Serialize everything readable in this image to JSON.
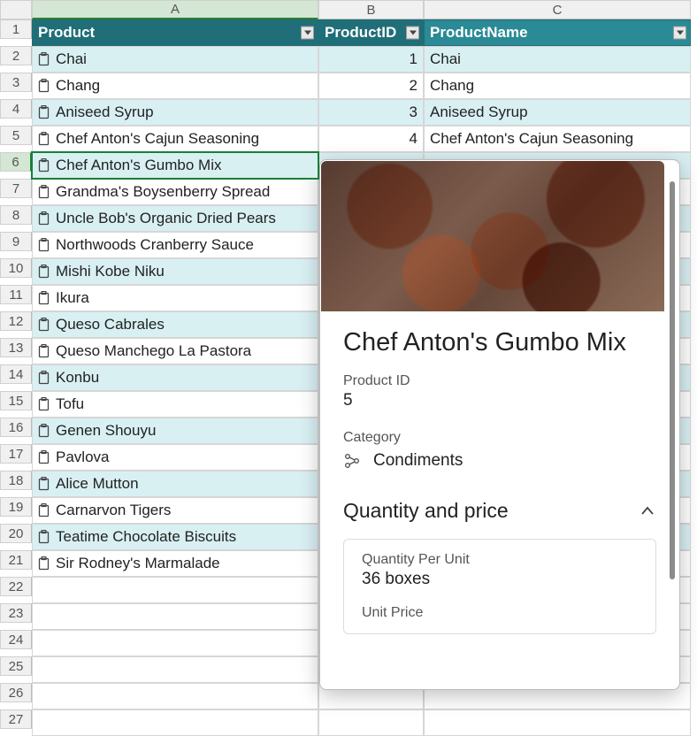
{
  "columns": {
    "A": "A",
    "B": "B",
    "C": "C"
  },
  "headers": {
    "product": "Product",
    "product_id": "ProductID",
    "product_name": "ProductName"
  },
  "rows": [
    {
      "product": "Chai",
      "id": "1",
      "name": "Chai"
    },
    {
      "product": "Chang",
      "id": "2",
      "name": "Chang"
    },
    {
      "product": "Aniseed Syrup",
      "id": "3",
      "name": "Aniseed Syrup"
    },
    {
      "product": "Chef Anton's Cajun Seasoning",
      "id": "4",
      "name": "Chef Anton's Cajun Seasoning"
    },
    {
      "product": "Chef Anton's Gumbo Mix",
      "id": "",
      "name": ""
    },
    {
      "product": "Grandma's Boysenberry Spread",
      "id": "",
      "name": ""
    },
    {
      "product": "Uncle Bob's Organic Dried Pears",
      "id": "",
      "name": ""
    },
    {
      "product": "Northwoods Cranberry Sauce",
      "id": "",
      "name": ""
    },
    {
      "product": "Mishi Kobe Niku",
      "id": "",
      "name": ""
    },
    {
      "product": "Ikura",
      "id": "",
      "name": ""
    },
    {
      "product": "Queso Cabrales",
      "id": "",
      "name": ""
    },
    {
      "product": "Queso Manchego La Pastora",
      "id": "",
      "name": ""
    },
    {
      "product": "Konbu",
      "id": "",
      "name": ""
    },
    {
      "product": "Tofu",
      "id": "",
      "name": ""
    },
    {
      "product": "Genen Shouyu",
      "id": "",
      "name": ""
    },
    {
      "product": "Pavlova",
      "id": "",
      "name": ""
    },
    {
      "product": "Alice Mutton",
      "id": "",
      "name": ""
    },
    {
      "product": "Carnarvon Tigers",
      "id": "",
      "name": ""
    },
    {
      "product": "Teatime Chocolate Biscuits",
      "id": "",
      "name": ""
    },
    {
      "product": "Sir Rodney's Marmalade",
      "id": "",
      "name": ""
    }
  ],
  "row_numbers": [
    "1",
    "2",
    "3",
    "4",
    "5",
    "6",
    "7",
    "8",
    "9",
    "10",
    "11",
    "12",
    "13",
    "14",
    "15",
    "16",
    "17",
    "18",
    "19",
    "20",
    "21",
    "22",
    "23",
    "24",
    "25",
    "26",
    "27"
  ],
  "selected_row_index": 4,
  "card": {
    "title": "Chef Anton's Gumbo Mix",
    "product_id_label": "Product ID",
    "product_id_value": "5",
    "category_label": "Category",
    "category_value": "Condiments",
    "section_title": "Quantity and price",
    "qty_label": "Quantity Per Unit",
    "qty_value": "36 boxes",
    "unitprice_label": "Unit Price"
  }
}
